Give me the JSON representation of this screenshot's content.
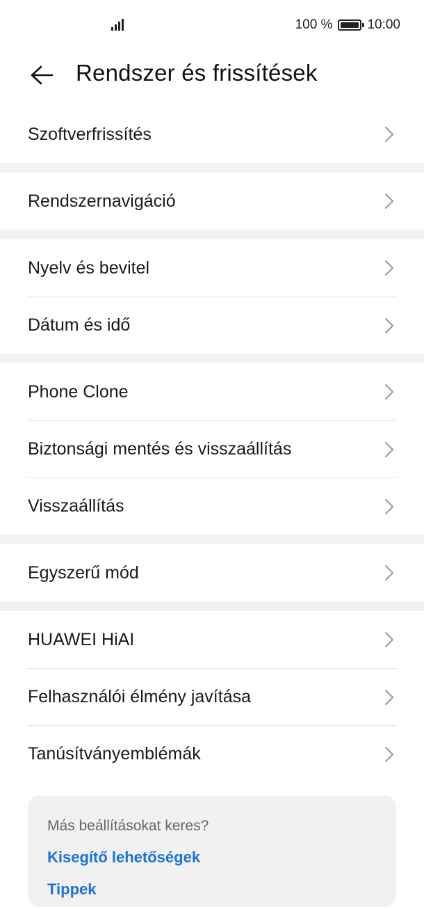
{
  "status_bar": {
    "battery_percent": "100 %",
    "time": "10:00"
  },
  "header": {
    "title": "Rendszer és frissítések"
  },
  "groups": [
    {
      "items": [
        {
          "label": "Szoftverfrissítés"
        }
      ]
    },
    {
      "items": [
        {
          "label": "Rendszernavigáció"
        }
      ]
    },
    {
      "items": [
        {
          "label": "Nyelv és bevitel"
        },
        {
          "label": "Dátum és idő"
        }
      ]
    },
    {
      "items": [
        {
          "label": "Phone Clone"
        },
        {
          "label": "Biztonsági mentés és visszaállítás"
        },
        {
          "label": "Visszaállítás"
        }
      ]
    },
    {
      "items": [
        {
          "label": "Egyszerű mód"
        }
      ]
    },
    {
      "items": [
        {
          "label": "HUAWEI HiAI"
        },
        {
          "label": "Felhasználói élmény javítása"
        },
        {
          "label": "Tanúsítványemblémák"
        }
      ]
    }
  ],
  "suggestions": {
    "question": "Más beállításokat keres?",
    "links": [
      {
        "label": "Kisegítő lehetőségek"
      },
      {
        "label": "Tippek"
      }
    ]
  },
  "colors": {
    "accent_link": "#1a73d9",
    "group_gap": "#f2f2f2",
    "card_bg": "#f1f1f1"
  },
  "icons": [
    "signal-icon",
    "battery-icon",
    "back-arrow-icon",
    "chevron-right-icon"
  ]
}
